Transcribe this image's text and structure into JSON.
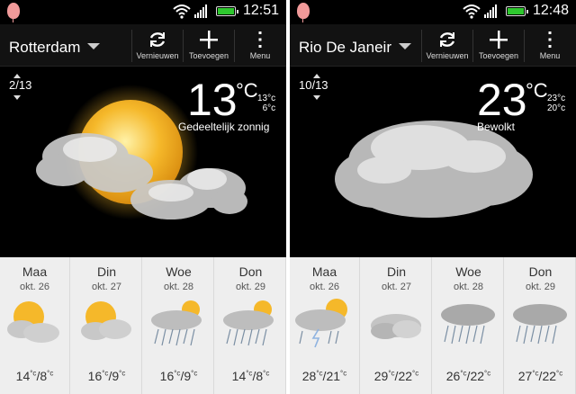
{
  "screens": [
    {
      "clock": "12:51",
      "city": "Rotterdam",
      "pager": "2/13",
      "temp": "13",
      "unit": "°C",
      "high": "13°c",
      "low": "6°c",
      "condition": "Gedeeltelijk zonnig",
      "actions": {
        "refresh": "Vernieuwen",
        "add": "Toevoegen",
        "menu": "Menu"
      },
      "forecast": [
        {
          "day": "Maa",
          "date": "okt. 26",
          "high": "14",
          "low": "8",
          "icon": "partly-sunny-icon"
        },
        {
          "day": "Din",
          "date": "okt. 27",
          "high": "16",
          "low": "9",
          "icon": "partly-sunny-icon"
        },
        {
          "day": "Woe",
          "date": "okt. 28",
          "high": "16",
          "low": "9",
          "icon": "rain-sun-icon"
        },
        {
          "day": "Don",
          "date": "okt. 29",
          "high": "14",
          "low": "8",
          "icon": "rain-sun-icon"
        }
      ]
    },
    {
      "clock": "12:48",
      "city": "Rio De Janeir",
      "pager": "10/13",
      "temp": "23",
      "unit": "°C",
      "high": "23°c",
      "low": "20°c",
      "condition": "Bewolkt",
      "actions": {
        "refresh": "Vernieuwen",
        "add": "Toevoegen",
        "menu": "Menu"
      },
      "forecast": [
        {
          "day": "Maa",
          "date": "okt. 26",
          "high": "28",
          "low": "21",
          "icon": "thunder-sun-icon"
        },
        {
          "day": "Din",
          "date": "okt. 27",
          "high": "29",
          "low": "22",
          "icon": "cloudy-icon"
        },
        {
          "day": "Woe",
          "date": "okt. 28",
          "high": "26",
          "low": "22",
          "icon": "rain-icon"
        },
        {
          "day": "Don",
          "date": "okt. 29",
          "high": "27",
          "low": "22",
          "icon": "rain-icon"
        }
      ]
    }
  ],
  "unit_small": "°c",
  "colors": {
    "battery": "#2ec82e",
    "sun": "#f5b82a",
    "balloon": "#f19a9a"
  }
}
